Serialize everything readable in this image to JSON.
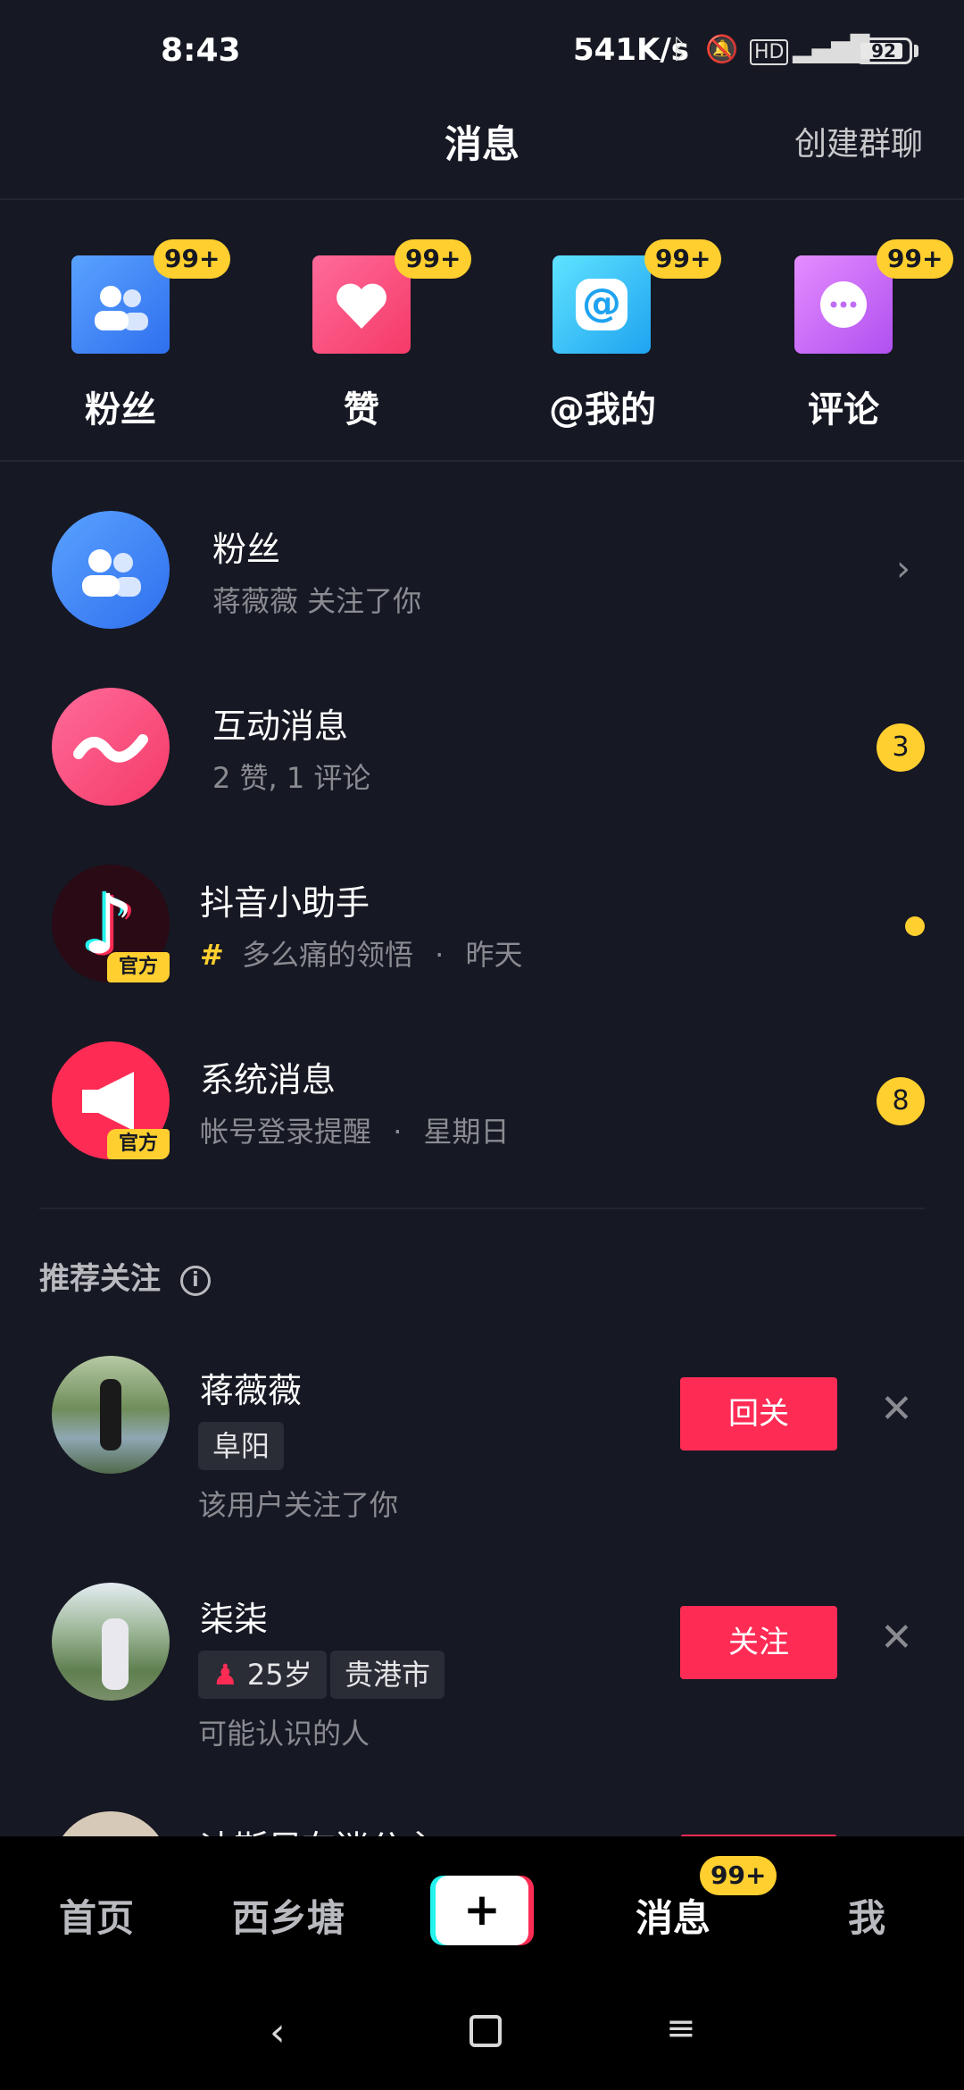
{
  "status_bar": {
    "time": "8:43",
    "network_speed": "541K/s",
    "battery": "92"
  },
  "header": {
    "title": "消息",
    "create_group": "创建群聊"
  },
  "shortcuts": [
    {
      "label": "粉丝",
      "badge": "99+",
      "icon": "fans-icon"
    },
    {
      "label": "赞",
      "badge": "99+",
      "icon": "heart-icon"
    },
    {
      "label": "@我的",
      "badge": "99+",
      "icon": "at-icon"
    },
    {
      "label": "评论",
      "badge": "99+",
      "icon": "comment-icon"
    }
  ],
  "messages": [
    {
      "title": "粉丝",
      "subtitle": "蒋薇薇 关注了你"
    },
    {
      "title": "互动消息",
      "subtitle": "2 赞, 1 评论",
      "badge": "3"
    },
    {
      "title": "抖音小助手",
      "subtitle_hash": "#",
      "subtitle": "多么痛的领悟",
      "time_sep": "·",
      "time": "昨天",
      "official": "官方"
    },
    {
      "title": "系统消息",
      "subtitle": "帐号登录提醒",
      "time_sep": "·",
      "time": "星期日",
      "official": "官方",
      "badge": "8"
    }
  ],
  "recommend": {
    "section_title": "推荐关注",
    "users": [
      {
        "name": "蒋薇薇",
        "tags": [
          "阜阳"
        ],
        "note": "该用户关注了你",
        "button": "回关"
      },
      {
        "name": "柒柒",
        "age": "25岁",
        "tags": [
          "贵港市"
        ],
        "note": "可能认识的人",
        "button": "关注"
      },
      {
        "name": "迪斯尼布迷公主"
      }
    ]
  },
  "bottom_nav": {
    "home": "首页",
    "local": "西乡塘",
    "plus": "+",
    "messages": "消息",
    "messages_badge": "99+",
    "me": "我"
  },
  "colors": {
    "background": "#161823",
    "accent_red": "#fe2c55",
    "badge_yellow": "#fecf2f"
  }
}
